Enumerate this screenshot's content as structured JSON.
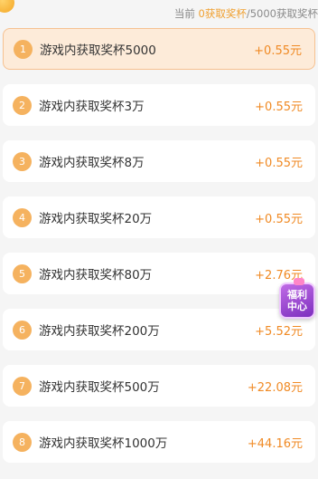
{
  "header": {
    "prefix": "当前 ",
    "current": "0获取奖杯",
    "separator": "/",
    "target": "5000获取奖杯"
  },
  "tasks": [
    {
      "index": "1",
      "label": "游戏内获取奖杯5000",
      "reward": "+0.55元",
      "active": true
    },
    {
      "index": "2",
      "label": "游戏内获取奖杯3万",
      "reward": "+0.55元"
    },
    {
      "index": "3",
      "label": "游戏内获取奖杯8万",
      "reward": "+0.55元"
    },
    {
      "index": "4",
      "label": "游戏内获取奖杯20万",
      "reward": "+0.55元"
    },
    {
      "index": "5",
      "label": "游戏内获取奖杯80万",
      "reward": "+2.76元"
    },
    {
      "index": "6",
      "label": "游戏内获取奖杯200万",
      "reward": "+5.52元"
    },
    {
      "index": "7",
      "label": "游戏内获取奖杯500万",
      "reward": "+22.08元"
    },
    {
      "index": "8",
      "label": "游戏内获取奖杯1000万",
      "reward": "+44.16元"
    }
  ],
  "float_badge": {
    "line1": "福利",
    "line2": "中心"
  },
  "colors": {
    "accent": "#f08a24",
    "number_circle": "#f5b25f",
    "active_bg": "#fdebd9",
    "badge": "#9b45d6"
  }
}
